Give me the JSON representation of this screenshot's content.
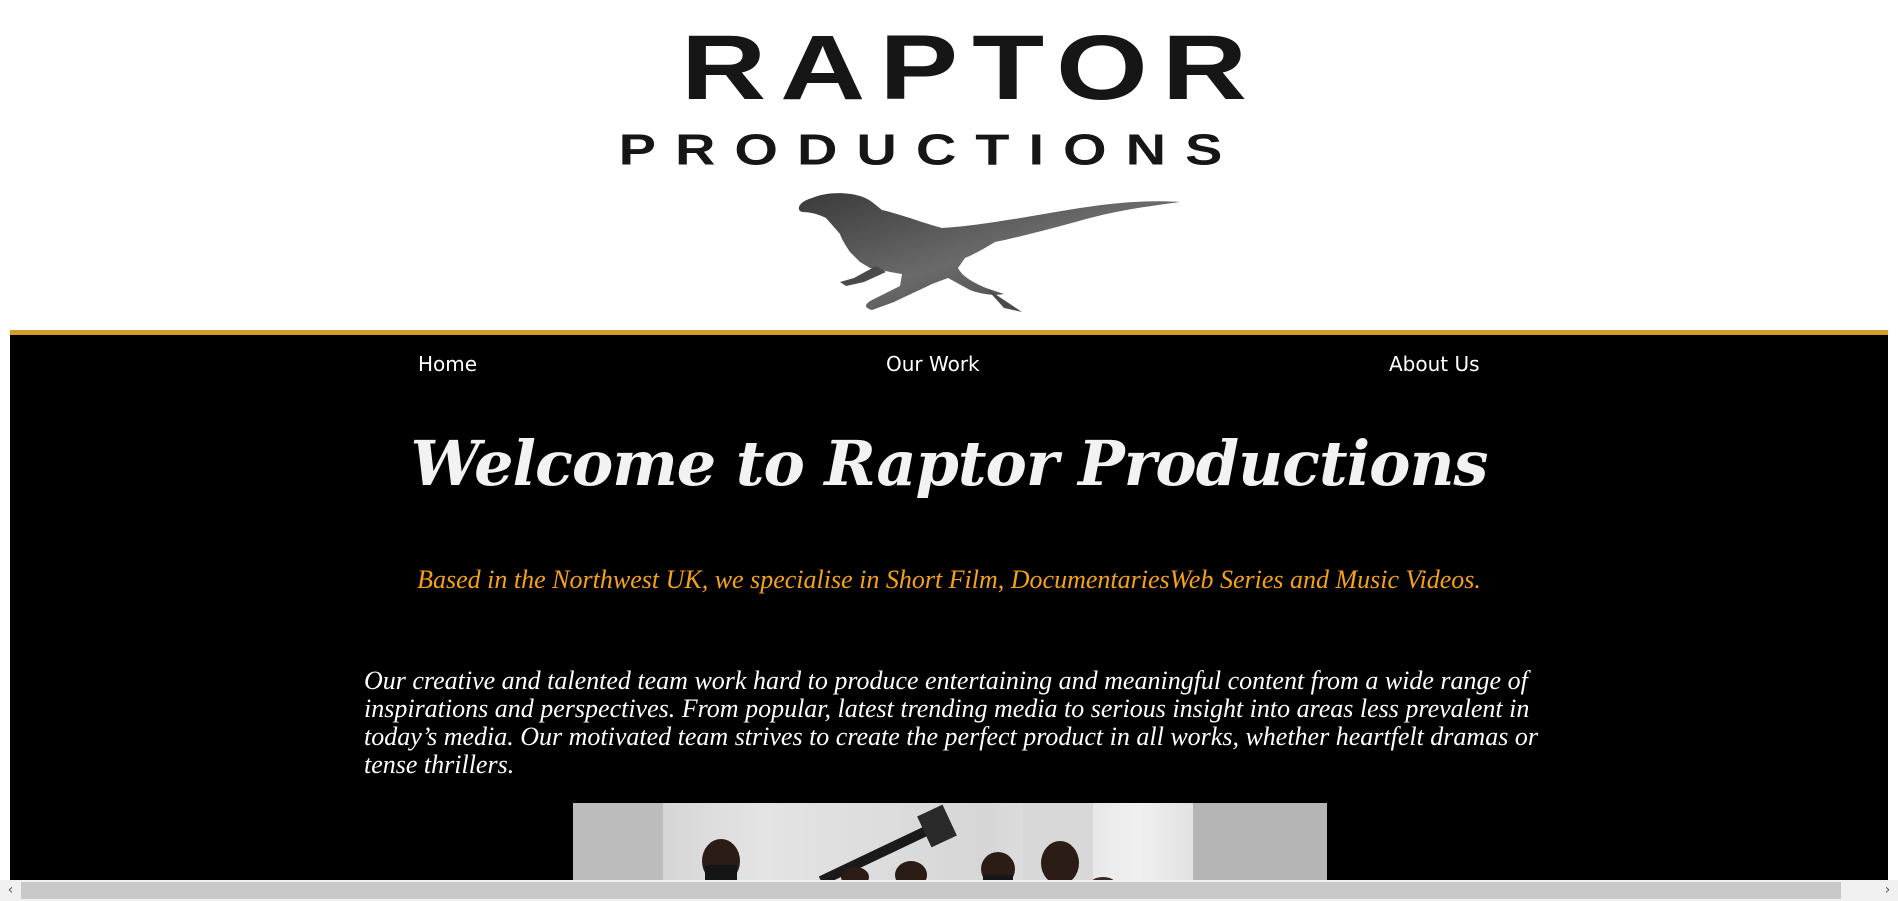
{
  "logo": {
    "line1": "RAPTOR",
    "line2": "PRODUCTIONS",
    "mascot": "raptor-silhouette"
  },
  "nav": {
    "items": [
      {
        "label": "Home"
      },
      {
        "label": "Our Work"
      },
      {
        "label": "About Us"
      }
    ]
  },
  "hero": {
    "title": "Welcome to Raptor Productions",
    "tagline": "Based in the Northwest UK, we specialise in Short Film, DocumentariesWeb Series and Music Videos.",
    "body": "Our creative and talented team work hard to produce entertaining and meaningful content from a wide range of inspirations and perspectives. From popular, latest trending media to serious insight into areas less prevalent in today’s media. Our motivated team strives to create the perfect product in all works, whether heartfelt dramas or tense thrillers."
  },
  "image": {
    "alt": "team-photo"
  },
  "scrollbar": {
    "left_icon": "chevron-left-icon",
    "right_icon": "chevron-right-icon"
  },
  "colors": {
    "accent": "#d39b2a",
    "tagline": "#f3a21d",
    "background": "#000000",
    "header_background": "#ffffff"
  }
}
